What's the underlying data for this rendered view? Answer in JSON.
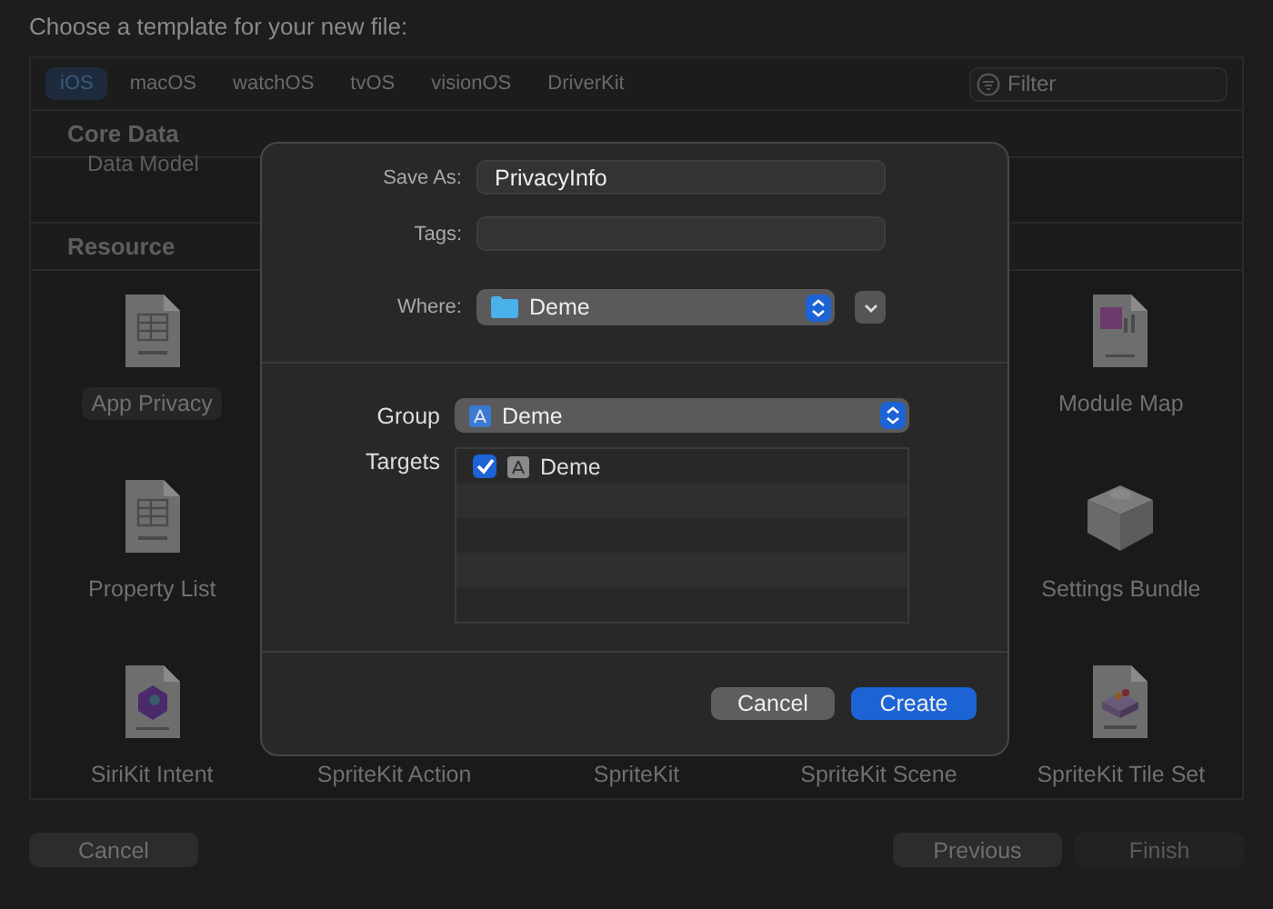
{
  "title": "Choose a template for your new file:",
  "platform_tabs": [
    {
      "label": "iOS",
      "selected": true
    },
    {
      "label": "macOS",
      "selected": false
    },
    {
      "label": "watchOS",
      "selected": false
    },
    {
      "label": "tvOS",
      "selected": false
    },
    {
      "label": "visionOS",
      "selected": false
    },
    {
      "label": "DriverKit",
      "selected": false
    }
  ],
  "filter": {
    "placeholder": "Filter"
  },
  "core_data": {
    "title": "Core Data",
    "items": [
      {
        "label": "Data Model"
      }
    ]
  },
  "resource": {
    "title": "Resource",
    "rows": [
      [
        {
          "label": "App Privacy",
          "kind": "plist",
          "selected": true
        },
        null,
        null,
        null,
        {
          "label": "Module Map",
          "kind": "modulemap",
          "selected": false
        }
      ],
      [
        {
          "label": "Property List",
          "kind": "plist",
          "selected": false
        },
        null,
        null,
        null,
        {
          "label": "Settings Bundle",
          "kind": "bundle",
          "selected": false
        }
      ],
      [
        {
          "label": "SiriKit Intent",
          "kind": "intents",
          "selected": false
        },
        {
          "label": "SpriteKit Action",
          "selected": false
        },
        {
          "label": "SpriteKit",
          "selected": false
        },
        {
          "label": "SpriteKit Scene",
          "selected": false
        },
        {
          "label": "SpriteKit Tile Set",
          "kind": "tileset",
          "selected": false
        }
      ]
    ]
  },
  "footer": {
    "cancel": {
      "label": "Cancel",
      "disabled": false
    },
    "previous": {
      "label": "Previous",
      "disabled": false
    },
    "finish": {
      "label": "Finish",
      "disabled": true
    }
  },
  "sheet": {
    "save_as": {
      "label": "Save As:",
      "value": "PrivacyInfo"
    },
    "tags": {
      "label": "Tags:"
    },
    "where": {
      "label": "Where:",
      "value": "Deme"
    },
    "group": {
      "label": "Group",
      "value": "Deme"
    },
    "targets": {
      "label": "Targets",
      "items": [
        {
          "name": "Deme",
          "checked": true
        }
      ]
    },
    "buttons": [
      {
        "label": "Cancel",
        "kind": "normal"
      },
      {
        "label": "Create",
        "kind": "default"
      }
    ]
  }
}
